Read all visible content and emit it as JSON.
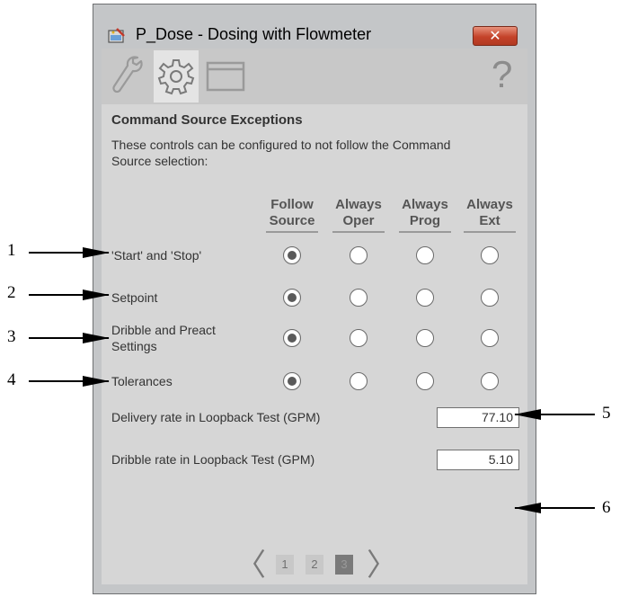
{
  "window": {
    "title": "P_Dose - Dosing with Flowmeter",
    "close_glyph": "✕"
  },
  "toolbar": {
    "tabs": [
      "wrench-icon",
      "gear-icon",
      "window-icon"
    ],
    "active_tab": "gear-icon",
    "help_glyph": "?"
  },
  "section": {
    "title": "Command Source Exceptions",
    "description": "These controls can be configured to not follow the Command Source selection:"
  },
  "columns": [
    {
      "line1": "Follow",
      "line2": "Source"
    },
    {
      "line1": "Always",
      "line2": "Oper"
    },
    {
      "line1": "Always",
      "line2": "Prog"
    },
    {
      "line1": "Always",
      "line2": "Ext"
    }
  ],
  "rows": [
    {
      "label": "'Start' and 'Stop'",
      "selected": 0
    },
    {
      "label": "Setpoint",
      "selected": 0
    },
    {
      "label": "Dribble and Preact Settings",
      "selected": 0
    },
    {
      "label": "Tolerances",
      "selected": 0
    }
  ],
  "fields": [
    {
      "label": "Delivery rate in Loopback Test (GPM)",
      "value": "77.10"
    },
    {
      "label": "Dribble rate in Loopback Test (GPM)",
      "value": "5.10"
    }
  ],
  "pager": {
    "prev": "〈",
    "next": "〉",
    "pages": [
      "1",
      "2",
      "3"
    ],
    "current": "3"
  },
  "callouts": [
    "1",
    "2",
    "3",
    "4",
    "5",
    "6"
  ]
}
